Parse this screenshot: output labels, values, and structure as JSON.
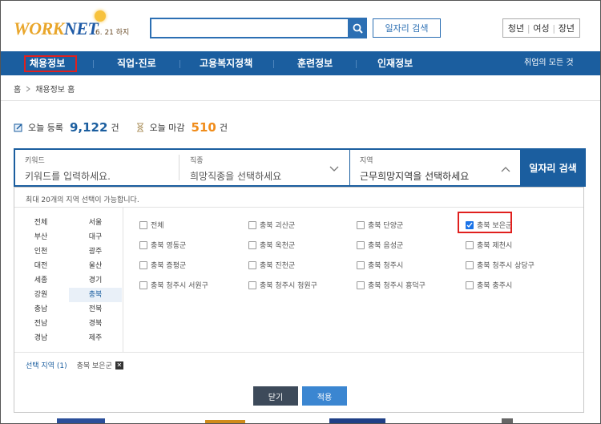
{
  "header": {
    "logo": {
      "brand_first": "W",
      "brand_mid": "ORK",
      "brand_net": "NET",
      "date_label": "6. 21 하지"
    },
    "search": {
      "button_icon": "search-icon",
      "job_search_label": "일자리 검색"
    },
    "targets": [
      "청년",
      "여성",
      "장년"
    ]
  },
  "nav": {
    "items": [
      "채용정보",
      "직업·진로",
      "고용복지정책",
      "훈련정보",
      "인재정보"
    ],
    "all_services": "취업의 모든 것"
  },
  "breadcrumb": {
    "home": "홈",
    "current": "채용정보 홈"
  },
  "stats": {
    "today_registered_label": "오늘 등록",
    "today_registered_value": "9,122",
    "today_registered_unit": "건",
    "today_deadline_label": "오늘 마감",
    "today_deadline_value": "510",
    "today_deadline_unit": "건"
  },
  "filter": {
    "keyword": {
      "label": "키워드",
      "placeholder": "키워드를 입력하세요."
    },
    "job": {
      "label": "직종",
      "value": "희망직종을 선택하세요"
    },
    "region": {
      "label": "지역",
      "value": "근무희망지역을 선택하세요"
    },
    "search_button": "일자리 검색"
  },
  "region_panel": {
    "note": "최대 20개의 지역 선택이 가능합니다.",
    "regions": [
      "전체",
      "서울",
      "부산",
      "대구",
      "인천",
      "광주",
      "대전",
      "울산",
      "세종",
      "경기",
      "강원",
      "충북",
      "충남",
      "전북",
      "전남",
      "경북",
      "경남",
      "제주"
    ],
    "selected_region": "충북",
    "subregions": [
      {
        "name": "전체",
        "checked": false
      },
      {
        "name": "충북 괴산군",
        "checked": false
      },
      {
        "name": "충북 단양군",
        "checked": false
      },
      {
        "name": "충북 보은군",
        "checked": true
      },
      {
        "name": "충북 영동군",
        "checked": false
      },
      {
        "name": "충북 옥천군",
        "checked": false
      },
      {
        "name": "충북 음성군",
        "checked": false
      },
      {
        "name": "충북 제천시",
        "checked": false
      },
      {
        "name": "충북 증평군",
        "checked": false
      },
      {
        "name": "충북 진천군",
        "checked": false
      },
      {
        "name": "충북 청주시",
        "checked": false
      },
      {
        "name": "충북 청주시 상당구",
        "checked": false
      },
      {
        "name": "충북 청주시 서원구",
        "checked": false
      },
      {
        "name": "충북 청주시 청원구",
        "checked": false
      },
      {
        "name": "충북 청주시 흥덕구",
        "checked": false
      },
      {
        "name": "충북 충주시",
        "checked": false
      }
    ],
    "selected_label": "선택 지역 (1)",
    "selected_items": [
      "충북 보은군"
    ],
    "close_button": "닫기",
    "apply_button": "적용"
  },
  "colors": {
    "brand_blue": "#1b5e9f",
    "accent_orange": "#f08c1a",
    "highlight_red": "#e0201e"
  }
}
